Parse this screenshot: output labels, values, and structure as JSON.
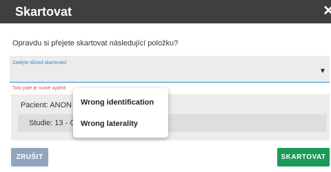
{
  "dialog": {
    "title": "Skartovat",
    "close_glyph": "✕"
  },
  "question": "Opravdu si přejete skartovat následující položku?",
  "reason_field": {
    "label": "Zadejte důvod skartování",
    "value": "",
    "dropdown_icon": "caret-down-icon"
  },
  "error_text": "Toto pole je nutné vyplnit",
  "patient": {
    "text": "Pacient: ANON",
    "study_text": "Studie: 13 - C"
  },
  "dropdown_menu": {
    "options": [
      "Wrong identification",
      "Wrong laterality"
    ]
  },
  "buttons": {
    "cancel_label": "ZRUŠIT",
    "confirm_label": "SKARTOVAT"
  },
  "colors": {
    "titlebar": "#3f3f3f",
    "accent": "#2a8fd0",
    "error": "#e04a4a",
    "cancel": "#8fa6bd",
    "confirm": "#1b9a58"
  }
}
